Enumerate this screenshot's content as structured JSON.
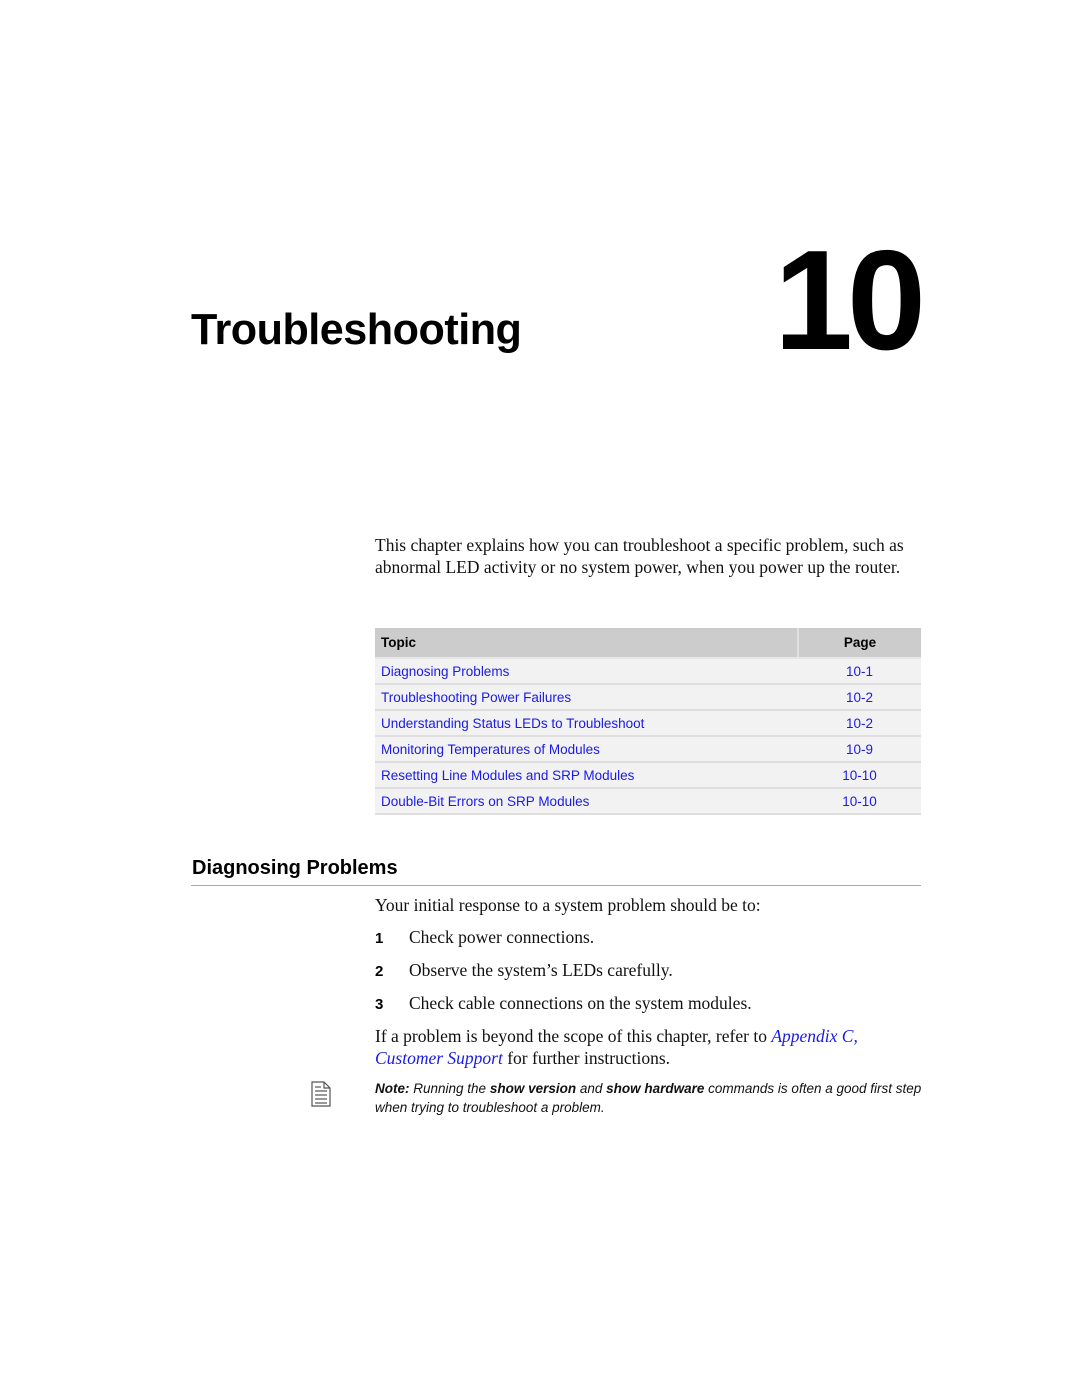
{
  "chapter": {
    "title": "Troubleshooting",
    "number": "10"
  },
  "intro": "This chapter explains how you can troubleshoot a specific problem, such as abnormal LED activity or no system power, when you power up the router.",
  "toc": {
    "headers": {
      "topic": "Topic",
      "page": "Page"
    },
    "rows": [
      {
        "topic": "Diagnosing Problems",
        "page": "10-1"
      },
      {
        "topic": "Troubleshooting Power Failures",
        "page": "10-2"
      },
      {
        "topic": "Understanding Status LEDs to Troubleshoot",
        "page": "10-2"
      },
      {
        "topic": "Monitoring Temperatures of Modules",
        "page": "10-9"
      },
      {
        "topic": "Resetting Line Modules and SRP Modules",
        "page": "10-10"
      },
      {
        "topic": "Double-Bit Errors on SRP Modules",
        "page": "10-10"
      }
    ]
  },
  "section": {
    "heading": "Diagnosing Problems",
    "lead": "Your initial response to a system problem should be to:",
    "steps": [
      {
        "num": "1",
        "text": "Check power connections."
      },
      {
        "num": "2",
        "text": "Observe the system’s LEDs carefully."
      },
      {
        "num": "3",
        "text": "Check cable connections on the system modules."
      }
    ],
    "refer": {
      "before": "If a problem is beyond the scope of this chapter, refer to ",
      "link": "Appendix C, Customer Support",
      "after": " for further instructions."
    },
    "note": {
      "icon": "note-document-icon",
      "label": "Note:",
      "part1": " Running the ",
      "cmd1": "show version",
      "part2": " and ",
      "cmd2": "show hardware",
      "part3": " commands is often a good first step when trying to troubleshoot a problem."
    }
  },
  "colors": {
    "link": "#1a1ae6",
    "table_header_bg": "#cccccc",
    "table_row_bg": "#f2f2f2",
    "rule": "#a8a8a8"
  }
}
